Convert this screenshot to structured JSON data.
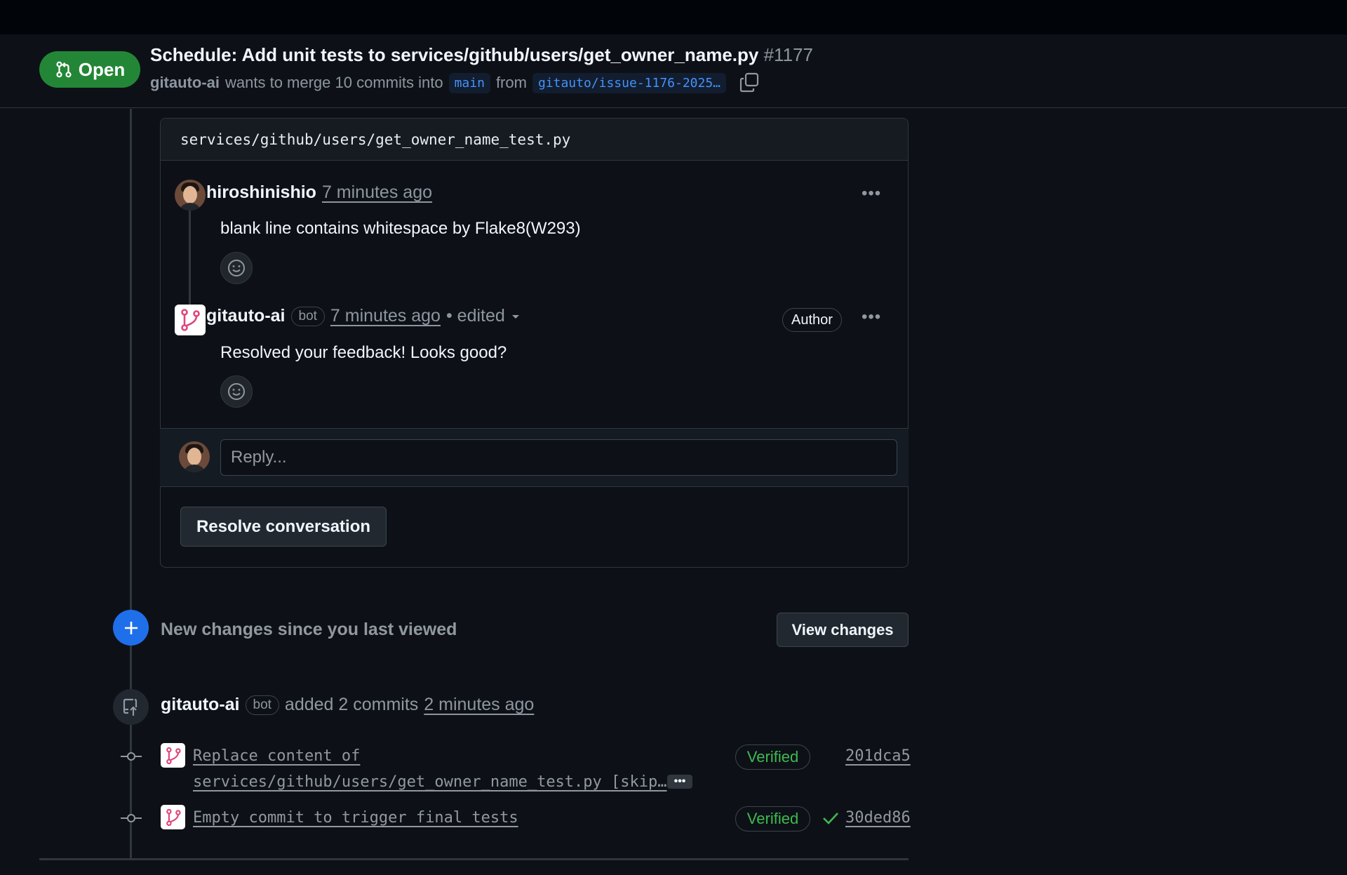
{
  "pr": {
    "state": "Open",
    "title": "Schedule: Add unit tests to services/github/users/get_owner_name.py",
    "number": "#1177",
    "author": "gitauto-ai",
    "merge_text": "wants to merge 10 commits into",
    "base_branch": "main",
    "from_text": "from",
    "head_branch": "gitauto/issue-1176-2025…"
  },
  "thread": {
    "file_path": "services/github/users/get_owner_name_test.py",
    "comments": [
      {
        "author": "hiroshinishio",
        "time": "7 minutes ago",
        "body": "blank line contains whitespace by Flake8(W293)"
      },
      {
        "author": "gitauto-ai",
        "bot_label": "bot",
        "time": "7 minutes ago",
        "edited": "• edited",
        "author_badge": "Author",
        "body": "Resolved your feedback! Looks good?"
      }
    ],
    "reply_placeholder": "Reply...",
    "resolve_label": "Resolve conversation"
  },
  "new_changes": {
    "text": "New changes since you last viewed",
    "button": "View changes"
  },
  "push_event": {
    "actor": "gitauto-ai",
    "bot_label": "bot",
    "action": "added 2 commits",
    "time": "2 minutes ago"
  },
  "commits": [
    {
      "message_line1": "Replace content of",
      "message_line2": "services/github/users/get_owner_name_test.py [skip…",
      "verified": "Verified",
      "sha": "201dca5"
    },
    {
      "message_line1": "Empty commit to trigger final tests",
      "verified": "Verified",
      "sha": "30ded86"
    }
  ],
  "colors": {
    "open_green": "#238636",
    "verified_green": "#3fb950",
    "accent_blue": "#1f6feb",
    "branch_blue": "#4493f8",
    "background": "#0d1117"
  },
  "icons": {
    "state": "git-pull-request-icon",
    "copy": "copy-icon",
    "reaction": "smiley-icon",
    "kebab": "kebab-horizontal-icon",
    "new_changes": "plus-icon",
    "push": "repo-push-icon",
    "commit": "git-commit-icon",
    "check": "check-icon",
    "bot_avatar": "gitauto-logo-icon"
  }
}
